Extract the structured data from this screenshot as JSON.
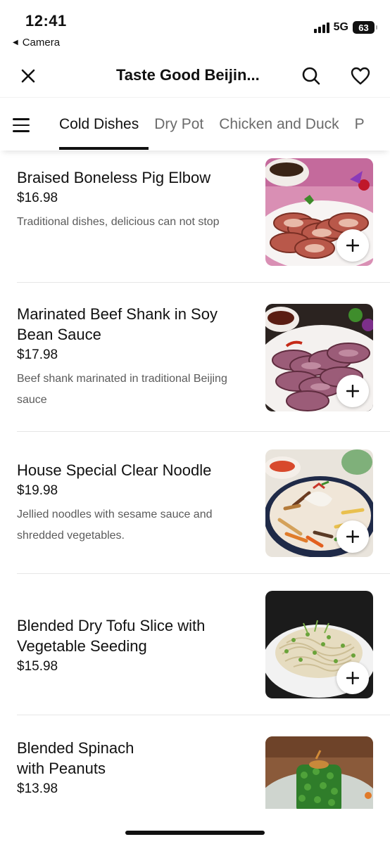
{
  "status_bar": {
    "time": "12:41",
    "back_label": "Camera",
    "network": "5G",
    "battery": "63"
  },
  "header": {
    "title": "Taste Good Beijin..."
  },
  "tabs": [
    {
      "label": "Cold Dishes",
      "active": true
    },
    {
      "label": "Dry Pot",
      "active": false
    },
    {
      "label": "Chicken and Duck",
      "active": false
    },
    {
      "label": "P",
      "active": false
    }
  ],
  "menu_items": [
    {
      "name": "Braised Boneless Pig Elbow",
      "price": "$16.98",
      "description": "Traditional dishes, delicious can not stop"
    },
    {
      "name": "Marinated Beef Shank in Soy Bean Sauce",
      "price": "$17.98",
      "description": "Beef shank marinated in traditional Beijing sauce"
    },
    {
      "name": "House Special Clear Noodle",
      "price": "$19.98",
      "description": "Jellied noodles with sesame sauce and shredded vegetables."
    },
    {
      "name": "Blended Dry Tofu Slice with Vegetable Seeding",
      "price": "$15.98",
      "description": ""
    },
    {
      "name": "Blended Spinach with Peanuts",
      "price": "$13.98",
      "description": ""
    }
  ],
  "icons": {
    "close": "close-icon",
    "search": "search-icon",
    "favorite": "heart-icon",
    "menu": "hamburger-menu-icon",
    "add": "plus-icon"
  }
}
